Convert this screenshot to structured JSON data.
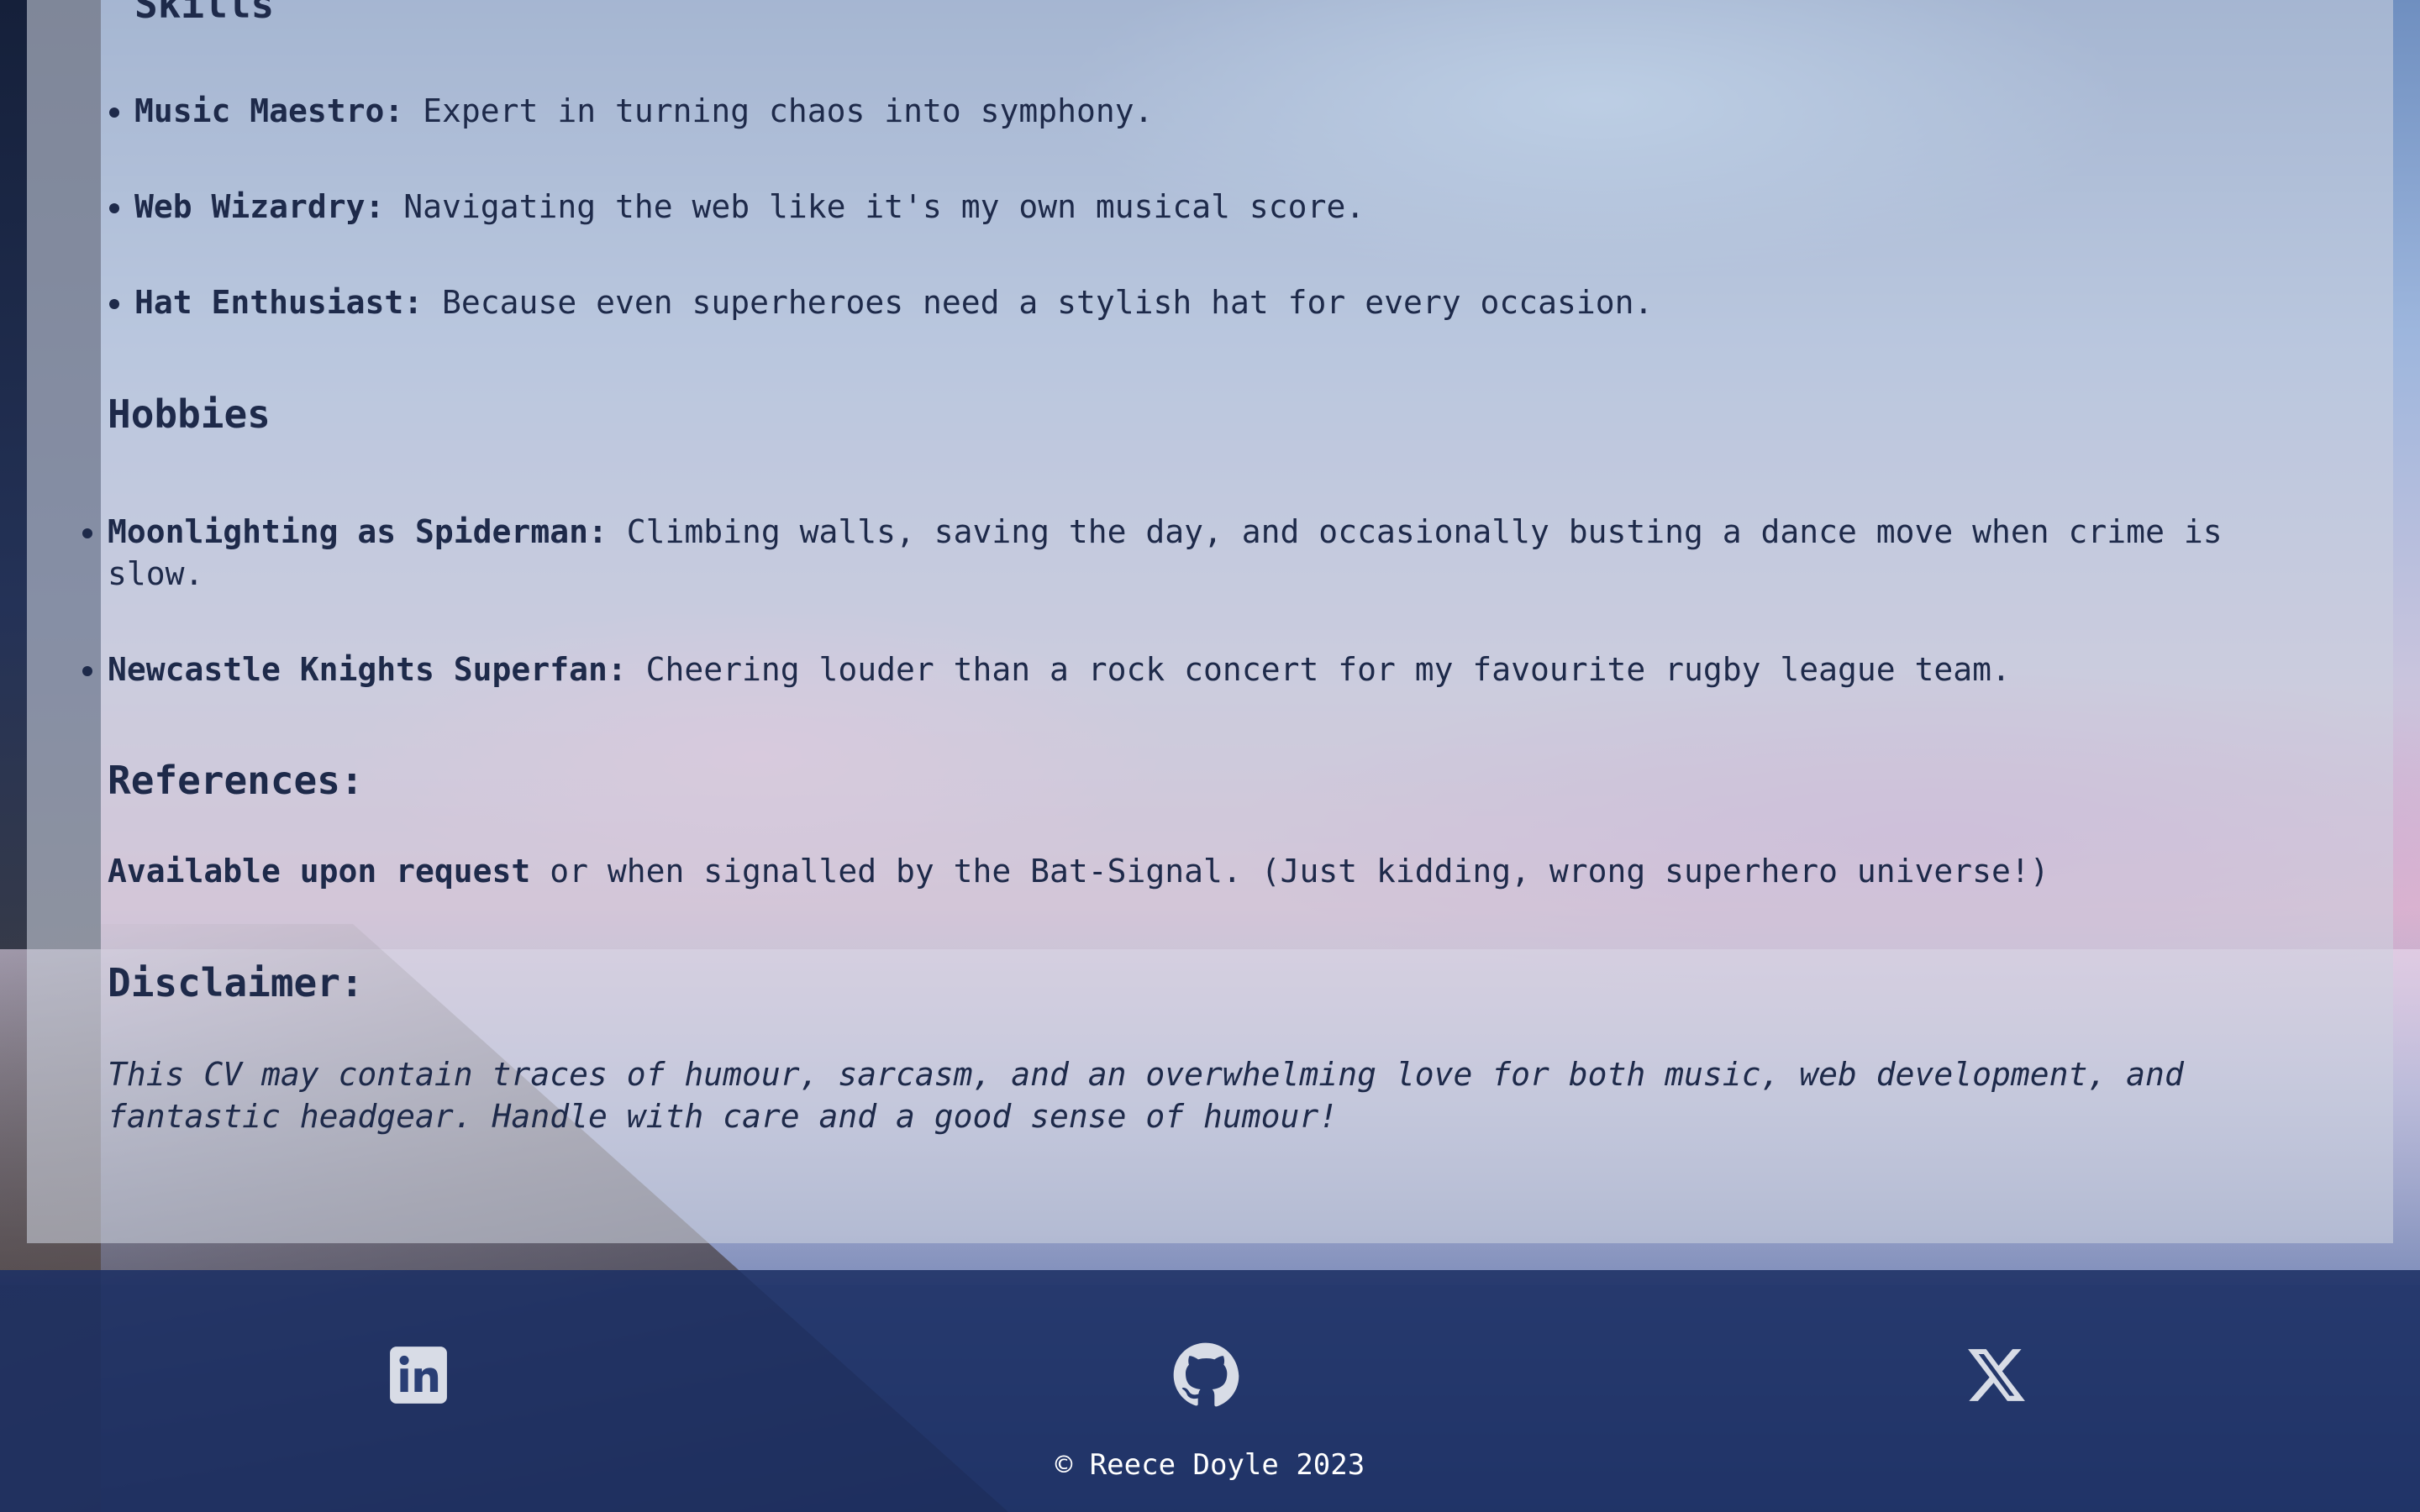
{
  "sections": {
    "skills": {
      "heading": "Skills",
      "items": [
        {
          "title": "Music Maestro:",
          "text": " Expert in turning chaos into symphony."
        },
        {
          "title": "Web Wizardry:",
          "text": " Navigating the web like it's my own musical score."
        },
        {
          "title": "Hat Enthusiast:",
          "text": " Because even superheroes need a stylish hat for every occasion."
        }
      ]
    },
    "hobbies": {
      "heading": "Hobbies",
      "items": [
        {
          "title": "Moonlighting as Spiderman:",
          "text": " Climbing walls, saving the day, and occasionally busting a dance move when crime is slow."
        },
        {
          "title": "Newcastle Knights Superfan:",
          "text": " Cheering louder than a rock concert for my favourite rugby league team."
        }
      ]
    },
    "references": {
      "heading": "References:",
      "bold": "Available upon request",
      "text": " or when signalled by the Bat-Signal. (Just kidding, wrong superhero universe!)"
    },
    "disclaimer": {
      "heading": "Disclaimer:",
      "text": "This CV may contain traces of humour, sarcasm, and an overwhelming love for both music, web development, and fantastic headgear. Handle with care and a good sense of humour!"
    }
  },
  "footer": {
    "links": [
      {
        "icon": "linkedin-icon"
      },
      {
        "icon": "github-icon"
      },
      {
        "icon": "x-twitter-icon"
      }
    ],
    "copyright": "© Reece Doyle 2023"
  },
  "colors": {
    "text": "#1e2a4a",
    "footer_bg": "#1c3064",
    "icon": "#d8dce6"
  }
}
